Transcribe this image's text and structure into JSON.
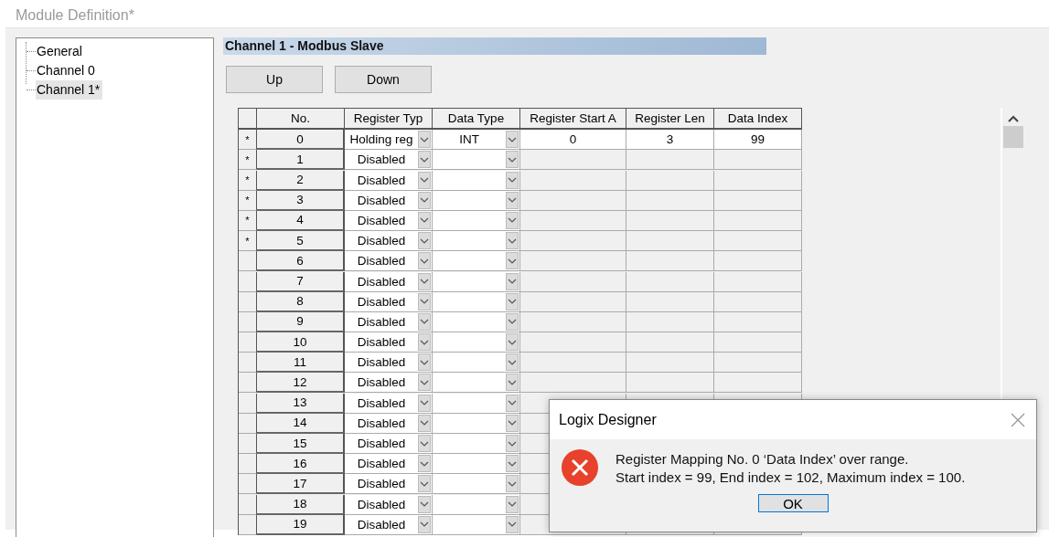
{
  "window": {
    "title": "Module Definition*"
  },
  "tree": {
    "items": [
      {
        "label": "General",
        "selected": false
      },
      {
        "label": "Channel 0",
        "selected": false
      },
      {
        "label": "Channel 1*",
        "selected": true
      }
    ]
  },
  "panel": {
    "header": "Channel 1 - Modbus Slave",
    "buttons": [
      "Up",
      "Down"
    ]
  },
  "table": {
    "columns": [
      "No.",
      "Register Typ",
      "Data Type",
      "Register Start A",
      "Register Len",
      "Data Index"
    ],
    "rows": [
      {
        "marker": "*",
        "no": "0",
        "register_type": "Holding reg",
        "data_type": "INT",
        "register_start": "0",
        "register_length": "3",
        "data_index": "99",
        "editable": true
      },
      {
        "marker": "*",
        "no": "1",
        "register_type": "Disabled",
        "editable": false
      },
      {
        "marker": "*",
        "no": "2",
        "register_type": "Disabled",
        "editable": false
      },
      {
        "marker": "*",
        "no": "3",
        "register_type": "Disabled",
        "editable": false
      },
      {
        "marker": "*",
        "no": "4",
        "register_type": "Disabled",
        "editable": false
      },
      {
        "marker": "*",
        "no": "5",
        "register_type": "Disabled",
        "editable": false
      },
      {
        "no": "6",
        "register_type": "Disabled",
        "editable": false
      },
      {
        "no": "7",
        "register_type": "Disabled",
        "editable": false
      },
      {
        "no": "8",
        "register_type": "Disabled",
        "editable": false
      },
      {
        "no": "9",
        "register_type": "Disabled",
        "editable": false
      },
      {
        "no": "10",
        "register_type": "Disabled",
        "editable": false
      },
      {
        "no": "11",
        "register_type": "Disabled",
        "editable": false
      },
      {
        "no": "12",
        "register_type": "Disabled",
        "editable": false
      },
      {
        "no": "13",
        "register_type": "Disabled",
        "editable": false
      },
      {
        "no": "14",
        "register_type": "Disabled",
        "editable": false
      },
      {
        "no": "15",
        "register_type": "Disabled",
        "editable": false
      },
      {
        "no": "16",
        "register_type": "Disabled",
        "editable": false
      },
      {
        "no": "17",
        "register_type": "Disabled",
        "editable": false
      },
      {
        "no": "18",
        "register_type": "Disabled",
        "editable": false
      },
      {
        "no": "19",
        "register_type": "Disabled",
        "editable": false
      }
    ]
  },
  "dialog": {
    "title": "Logix Designer",
    "message": [
      "Register Mapping No. 0 ‘Data Index’ over range.",
      "Start index = 99, End index = 102, Maximum index = 100."
    ],
    "button": "OK"
  }
}
